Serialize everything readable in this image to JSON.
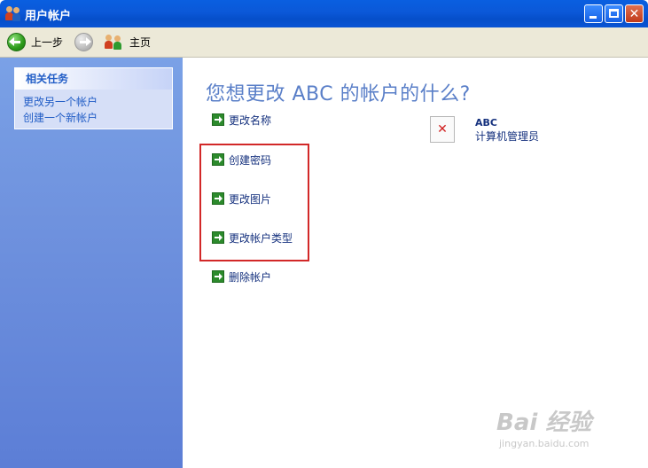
{
  "window": {
    "title": "用户帐户",
    "title_bar_color": "#0b58d8",
    "controls": {
      "minimize_icon": "minimize-icon",
      "maximize_icon": "maximize-icon",
      "close_icon": "close-icon",
      "close_glyph": "✕"
    }
  },
  "toolbar": {
    "back_label": "上一步",
    "home_label": "主页",
    "back_icon": "back-arrow-icon",
    "forward_icon": "forward-arrow-icon",
    "home_icon": "users-icon"
  },
  "sidebar": {
    "panel_title": "相关任务",
    "links": [
      "更改另一个帐户",
      "创建一个新帐户"
    ]
  },
  "main": {
    "heading": "您想更改 ABC 的帐户的什么?",
    "actions": [
      "更改名称",
      "创建密码",
      "更改图片",
      "更改帐户类型",
      "删除帐户"
    ],
    "action_icon": "green-arrow-icon",
    "highlight_color": "#d22828"
  },
  "account": {
    "name": "ABC",
    "type": "计算机管理员",
    "picture_glyph": "✕"
  },
  "watermark": {
    "line1": "Bai 经验",
    "line2": "jingyan.baidu.com"
  }
}
